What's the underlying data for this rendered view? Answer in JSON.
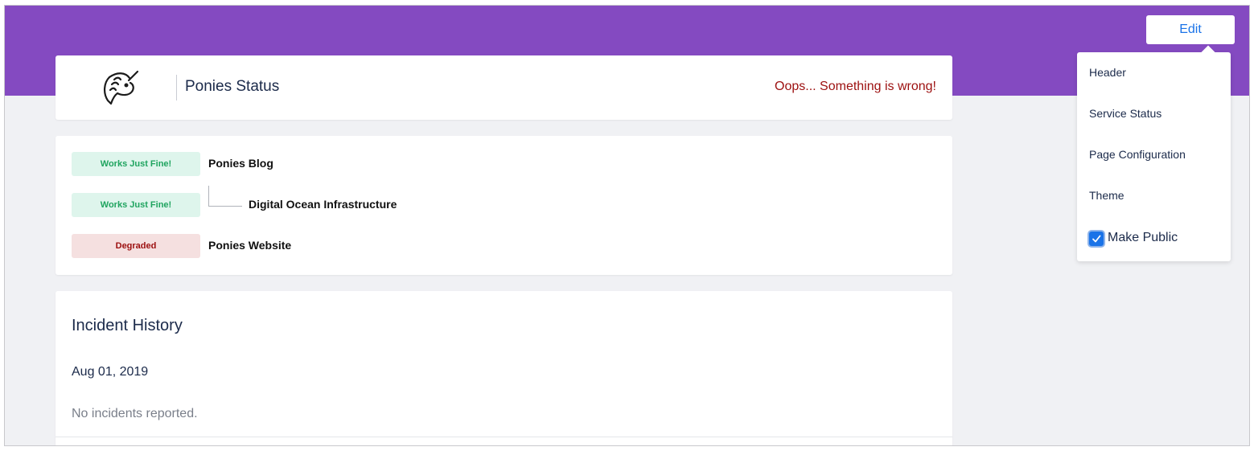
{
  "theme": {
    "banner_color": "#844ac1",
    "accent_color": "#1a73e8",
    "error_text_color": "#9c0f0f"
  },
  "toolbar": {
    "edit_label": "Edit"
  },
  "edit_menu": {
    "items": [
      {
        "label": "Header"
      },
      {
        "label": "Service Status"
      },
      {
        "label": "Page Configuration"
      },
      {
        "label": "Theme"
      }
    ],
    "make_public": {
      "label": "Make Public",
      "checked": true
    }
  },
  "header": {
    "logo_icon": "unicorn-icon",
    "title": "Ponies Status",
    "status_message": "Oops... Something is wrong!"
  },
  "services": [
    {
      "status": "Works Just Fine!",
      "name": "Ponies Blog",
      "status_bg": "#def5ec",
      "status_color": "#1fa45f"
    },
    {
      "status": "Works Just Fine!",
      "name": "Digital Ocean Infrastructure",
      "status_bg": "#def5ec",
      "status_color": "#1fa45f"
    },
    {
      "status": "Degraded",
      "name": "Ponies Website",
      "status_bg": "#f5e0e0",
      "status_color": "#9c0f0f"
    }
  ],
  "incidents": {
    "title": "Incident History",
    "days": [
      {
        "date": "Aug 01, 2019",
        "message": "No incidents reported."
      }
    ]
  }
}
